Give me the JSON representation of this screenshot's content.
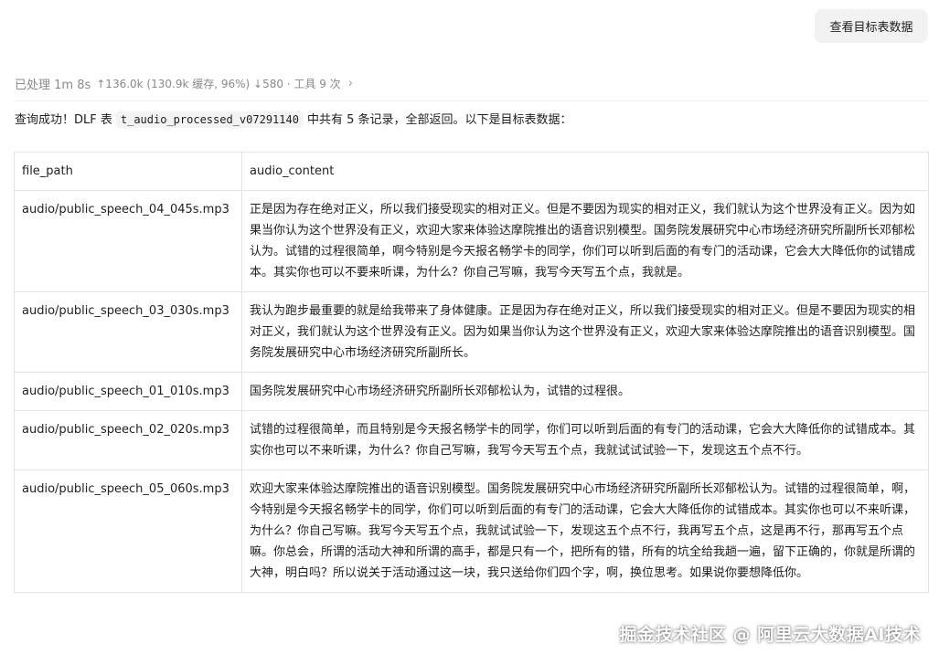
{
  "header": {
    "view_button": "查看目标表数据"
  },
  "status": {
    "processed": "已处理 1m 8s",
    "tokens": "↑136.0k (130.9k 缓存, 96%) ↓580 · 工具 9 次",
    "chevron_icon": "chevron-right-icon"
  },
  "summary": {
    "prefix": "查询成功！DLF 表",
    "table_name": "t_audio_processed_v07291140",
    "suffix": "中共有 5 条记录，全部返回。以下是目标表数据："
  },
  "table": {
    "columns": [
      "file_path",
      "audio_content"
    ],
    "rows": [
      {
        "file_path": "audio/public_speech_04_045s.mp3",
        "audio_content": "正是因为存在绝对正义，所以我们接受现实的相对正义。但是不要因为现实的相对正义，我们就认为这个世界没有正义。因为如果当你认为这个世界没有正义，欢迎大家来体验达摩院推出的语音识别模型。国务院发展研究中心市场经济研究所副所长邓郁松认为。试错的过程很简单，啊今特别是今天报名畅学卡的同学，你们可以听到后面的有专门的活动课，它会大大降低你的试错成本。其实你也可以不要来听课，为什么？你自己写嘛，我写今天写五个点，我就是。"
      },
      {
        "file_path": "audio/public_speech_03_030s.mp3",
        "audio_content": "我认为跑步最重要的就是给我带来了身体健康。正是因为存在绝对正义，所以我们接受现实的相对正义。但是不要因为现实的相对正义，我们就认为这个世界没有正义。因为如果当你认为这个世界没有正义，欢迎大家来体验达摩院推出的语音识别模型。国务院发展研究中心市场经济研究所副所长。"
      },
      {
        "file_path": "audio/public_speech_01_010s.mp3",
        "audio_content": "国务院发展研究中心市场经济研究所副所长邓郁松认为，试错的过程很。"
      },
      {
        "file_path": "audio/public_speech_02_020s.mp3",
        "audio_content": "试错的过程很简单，而且特别是今天报名畅学卡的同学，你们可以听到后面的有专门的活动课，它会大大降低你的试错成本。其实你也可以不来听课，为什么？你自己写嘛，我写今天写五个点，我就试试试验一下，发现这五个点不行。"
      },
      {
        "file_path": "audio/public_speech_05_060s.mp3",
        "audio_content": "欢迎大家来体验达摩院推出的语音识别模型。国务院发展研究中心市场经济研究所副所长邓郁松认为。试错的过程很简单，啊，今特别是今天报名畅学卡的同学，你们可以听到后面的有专门的活动课，它会大大降低你的试错成本。其实你也可以不来听课，为什么？你自己写嘛。我写今天写五个点，我就试试验一下，发现这五个点不行，我再写五个点，这是再不行，那再写五个点嘛。你总会，所谓的活动大神和所谓的高手，都是只有一个，把所有的错，所有的坑全给我趟一遍，留下正确的，你就是所谓的大神，明白吗？所以说关于活动通过这一块，我只送给你们四个字，啊，换位思考。如果说你要想降低你。"
      }
    ]
  },
  "watermark": "掘金技术社区 @ 阿里云大数据AI技术"
}
